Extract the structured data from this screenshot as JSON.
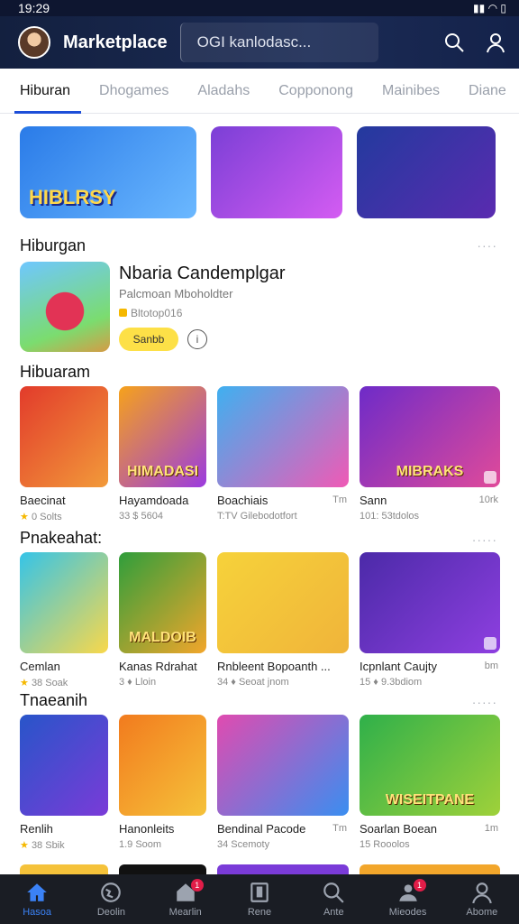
{
  "status": {
    "time": "19:29",
    "icons": "▮▮ ◠ ▯"
  },
  "header": {
    "title": "Marketplace",
    "search_placeholder": "OGI kanlodasc..."
  },
  "tabs": [
    {
      "label": "Hiburan",
      "active": true
    },
    {
      "label": "Dhogames"
    },
    {
      "label": "Aladahs"
    },
    {
      "label": "Copponong"
    },
    {
      "label": "Mainibes"
    },
    {
      "label": "Diane"
    }
  ],
  "banners": [
    {
      "text": "HIBLRSY",
      "colors": [
        "#2a7be8",
        "#6bb8ff"
      ]
    },
    {
      "text": "",
      "colors": [
        "#7b3fd6",
        "#d45cf2"
      ]
    },
    {
      "text": "",
      "colors": [
        "#233a9e",
        "#5a2bb0"
      ]
    }
  ],
  "featured": {
    "section_title": "Hiburgan",
    "more": "····",
    "name": "Nbaria Candemplgar",
    "subtitle": "Palcmoan Mboholdter",
    "meta": "Bltotop016",
    "button_label": "Sanbb",
    "info_icon": "i"
  },
  "sections": [
    {
      "title": "Hibuaram",
      "more": "",
      "cards": [
        {
          "name": "Baecinat",
          "meta": "0 Solts",
          "size": "",
          "overlay": "",
          "colors": [
            "#e23b2b",
            "#f29a3a"
          ]
        },
        {
          "name": "Hayamdoada",
          "meta": "33 $ 5604",
          "size": "",
          "overlay": "HIMADASI",
          "colors": [
            "#f6a21b",
            "#9b3be0"
          ]
        },
        {
          "name": "Boachiais",
          "meta": "T:TV Gilebodotfort",
          "size": "Tm",
          "overlay": "",
          "colors": [
            "#3fb0f0",
            "#f05ab5"
          ]
        },
        {
          "name": "Sann",
          "meta": "101: 53tdolos",
          "size": "10rk",
          "overlay": "MIBRAKS",
          "colors": [
            "#6e2bc8",
            "#e04a9a"
          ]
        }
      ]
    },
    {
      "title": "Pnakeahat:",
      "more": "·····",
      "cards": [
        {
          "name": "Cemlan",
          "meta": "38 Soak",
          "size": "",
          "overlay": "",
          "colors": [
            "#35c4e8",
            "#f9d84b"
          ]
        },
        {
          "name": "Kanas Rdrahat",
          "meta": "3 ♦ Lloin",
          "size": "",
          "overlay": "MALDOIB",
          "colors": [
            "#2f9e3b",
            "#f2a62b"
          ]
        },
        {
          "name": "Rnbleent Bopoanth ...",
          "meta": "34 ♦ Seoat jnom",
          "size": "",
          "overlay": "",
          "colors": [
            "#f6d23a",
            "#f0b43a"
          ]
        },
        {
          "name": "Icpnlant Caujty",
          "meta": "15 ♦ 9.3bdiom",
          "size": "bm",
          "overlay": "",
          "colors": [
            "#4b2aa8",
            "#8e3fe0"
          ]
        }
      ]
    },
    {
      "title": "Tnaeanih",
      "more": "·····",
      "cards": [
        {
          "name": "Renlih",
          "meta": "38 Sbik",
          "size": "",
          "overlay": "",
          "colors": [
            "#2855c9",
            "#7a3bd8"
          ]
        },
        {
          "name": "Hanonleits",
          "meta": "1.9 Soom",
          "size": "",
          "overlay": "",
          "colors": [
            "#f27b1e",
            "#f5c23a"
          ]
        },
        {
          "name": "Bendinal Pacode",
          "meta": "34 Scemoty",
          "size": "Tm",
          "overlay": "",
          "colors": [
            "#e04bb0",
            "#3a8ef0"
          ]
        },
        {
          "name": "Soarlan Boean",
          "meta": "15 Rooolos",
          "size": "1m",
          "overlay": "WISEITPANE",
          "colors": [
            "#2fb04a",
            "#9fd13a"
          ]
        }
      ]
    }
  ],
  "bottom_nav": [
    {
      "label": "Hasoa",
      "icon": "home-icon",
      "active": true,
      "badge": ""
    },
    {
      "label": "Deolin",
      "icon": "globe-icon",
      "badge": ""
    },
    {
      "label": "Mearlin",
      "icon": "house-icon",
      "badge": "1"
    },
    {
      "label": "Rene",
      "icon": "square-icon",
      "badge": ""
    },
    {
      "label": "Ante",
      "icon": "search-icon",
      "badge": ""
    },
    {
      "label": "Mieodes",
      "icon": "people-icon",
      "badge": "1"
    },
    {
      "label": "Abome",
      "icon": "profile-icon",
      "badge": ""
    }
  ]
}
